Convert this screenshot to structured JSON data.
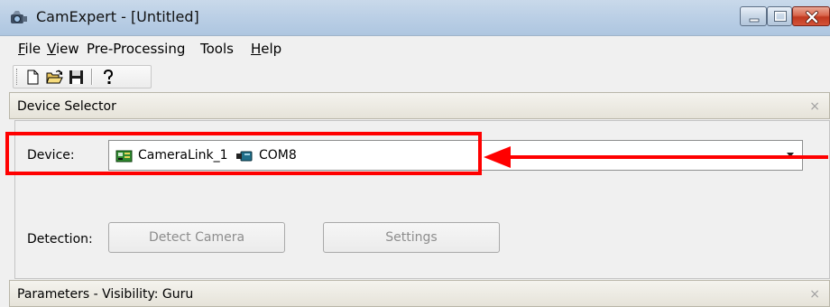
{
  "window": {
    "title": "CamExpert - [Untitled]"
  },
  "menu": {
    "items": [
      {
        "accel": "F",
        "rest": "ile"
      },
      {
        "accel": "V",
        "rest": "iew"
      },
      {
        "accel": "",
        "rest": "Pre-Processing"
      },
      {
        "accel": "",
        "rest": "Tools"
      },
      {
        "accel": "H",
        "rest": "elp"
      }
    ]
  },
  "toolbar": {
    "icons": [
      "new-file-icon",
      "open-folder-icon",
      "save-icon",
      "help-icon"
    ]
  },
  "device_selector": {
    "title": "Device Selector",
    "close_glyph": "×",
    "device_label": "Device:",
    "selected_device": "CameraLink_1",
    "selected_port": "COM8",
    "detection_label": "Detection:",
    "detect_button": "Detect Camera",
    "settings_button": "Settings"
  },
  "parameters_panel": {
    "title": "Parameters - Visibility: Guru",
    "close_glyph": "×"
  },
  "colors": {
    "annotation": "#ff0000",
    "titlebar": "#b9cee5",
    "disabled_text": "#8d8d8d"
  }
}
